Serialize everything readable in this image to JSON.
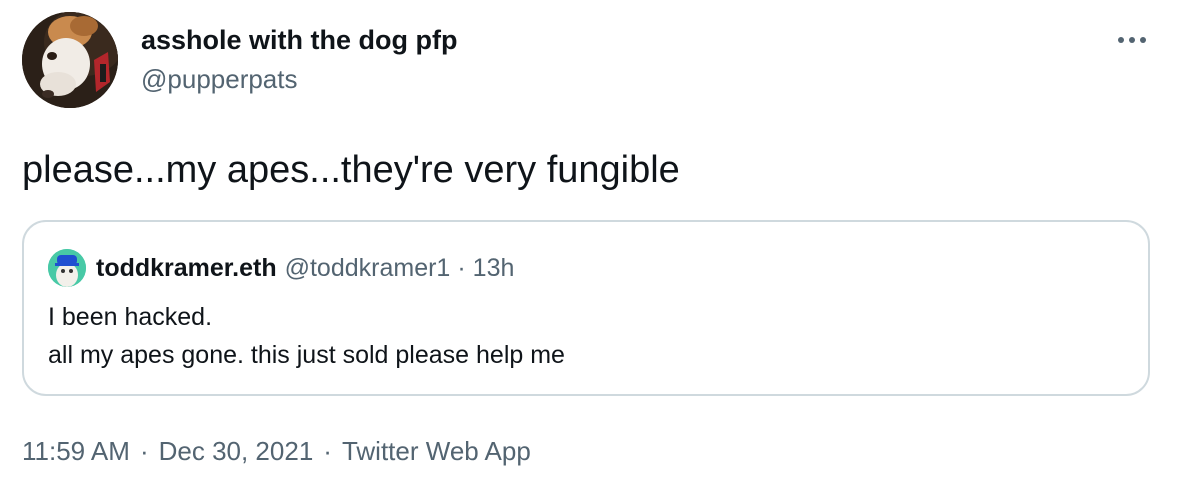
{
  "author": {
    "display_name": "asshole with the dog pfp",
    "handle": "@pupperpats"
  },
  "tweet": {
    "text": "please...my apes...they're very fungible"
  },
  "quoted_tweet": {
    "display_name": "toddkramer.eth",
    "handle": "@toddkramer1",
    "separator": "·",
    "time": "13h",
    "lines": [
      "I been hacked.",
      "all my apes gone. this just sold please help me"
    ]
  },
  "meta": {
    "time": "11:59 AM",
    "separator": "·",
    "date": "Dec 30, 2021",
    "source": "Twitter Web App"
  },
  "icons": {
    "more": "more-horizontal-icon"
  },
  "colors": {
    "text": "#0f1419",
    "secondary": "#536471",
    "border": "#cfd9de"
  }
}
